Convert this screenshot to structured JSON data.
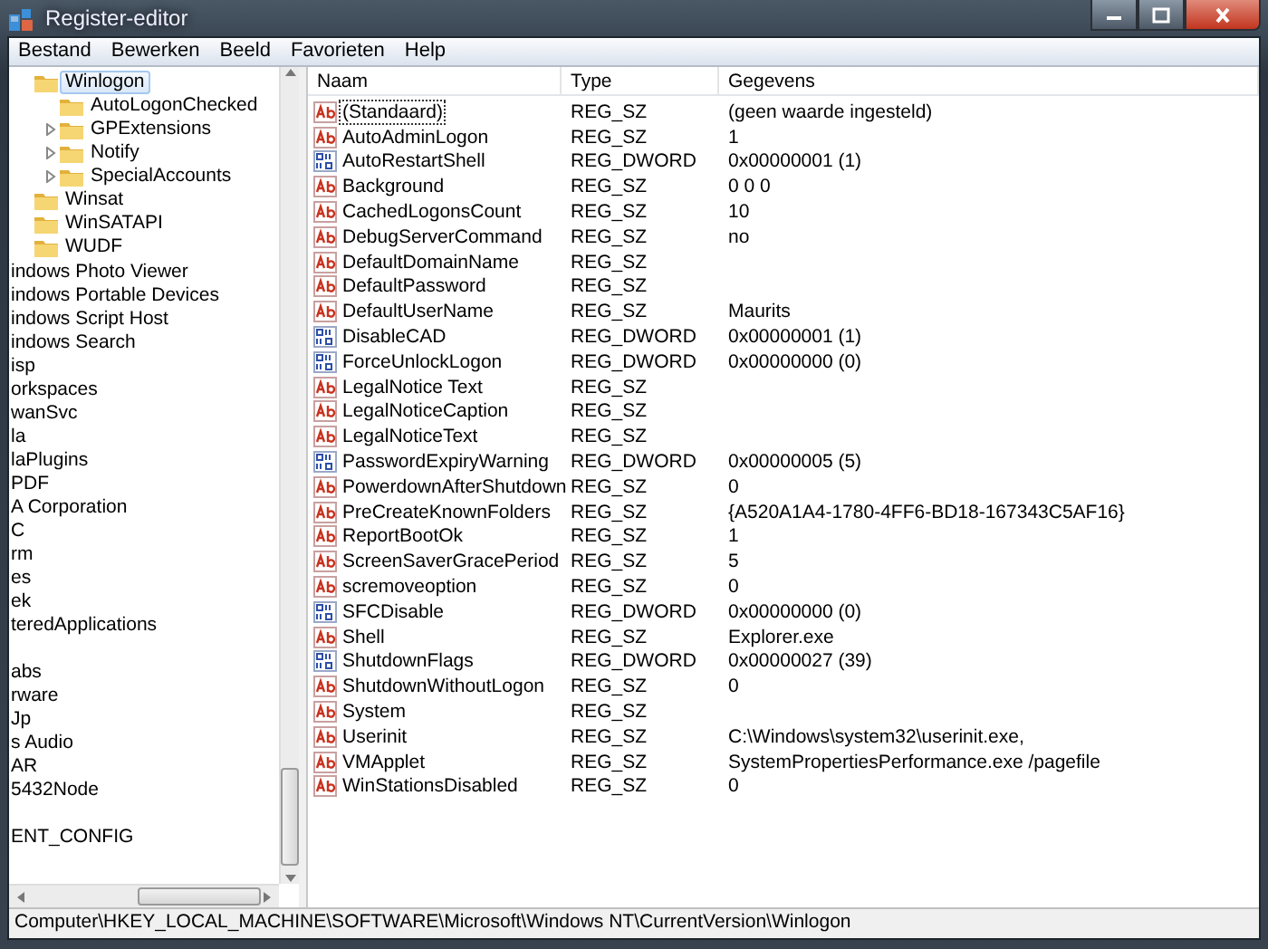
{
  "window": {
    "title": "Register-editor"
  },
  "menu": [
    "Bestand",
    "Bewerken",
    "Beeld",
    "Favorieten",
    "Help"
  ],
  "tree": {
    "nested_items": [
      {
        "label": "Winlogon",
        "selected": true,
        "expandable": false,
        "children": [
          {
            "label": "AutoLogonChecked",
            "selected": false,
            "expandable": false
          },
          {
            "label": "GPExtensions",
            "selected": false,
            "expandable": true
          },
          {
            "label": "Notify",
            "selected": false,
            "expandable": true
          },
          {
            "label": "SpecialAccounts",
            "selected": false,
            "expandable": true
          }
        ]
      },
      {
        "label": "Winsat",
        "selected": false,
        "expandable": false
      },
      {
        "label": "WinSATAPI",
        "selected": false,
        "expandable": false
      },
      {
        "label": "WUDF",
        "selected": false,
        "expandable": false
      }
    ],
    "items": [
      {
        "label": "indows Photo Viewer",
        "gap_before": false
      },
      {
        "label": "indows Portable Devices",
        "gap_before": false
      },
      {
        "label": "indows Script Host",
        "gap_before": false
      },
      {
        "label": "indows Search",
        "gap_before": false
      },
      {
        "label": "isp",
        "gap_before": false
      },
      {
        "label": "orkspaces",
        "gap_before": false
      },
      {
        "label": "wanSvc",
        "gap_before": false
      },
      {
        "label": "la",
        "gap_before": false
      },
      {
        "label": "laPlugins",
        "gap_before": false
      },
      {
        "label": "PDF",
        "gap_before": false
      },
      {
        "label": "A Corporation",
        "gap_before": false
      },
      {
        "label": "C",
        "gap_before": false
      },
      {
        "label": "rm",
        "gap_before": false
      },
      {
        "label": "es",
        "gap_before": false
      },
      {
        "label": "ek",
        "gap_before": false
      },
      {
        "label": "teredApplications",
        "gap_before": false
      },
      {
        "label": "abs",
        "gap_before": true
      },
      {
        "label": "rware",
        "gap_before": false
      },
      {
        "label": "Jp",
        "gap_before": false
      },
      {
        "label": "s Audio",
        "gap_before": false
      },
      {
        "label": "AR",
        "gap_before": false
      },
      {
        "label": "5432Node",
        "gap_before": false
      },
      {
        "label": "ENT_CONFIG",
        "gap_before": true
      }
    ]
  },
  "table": {
    "columns": [
      "Naam",
      "Type",
      "Gegevens"
    ],
    "rows": [
      {
        "kind": "string",
        "focused": true,
        "name": "(Standaard)",
        "type": "REG_SZ",
        "data": "(geen waarde ingesteld)"
      },
      {
        "kind": "string",
        "focused": false,
        "name": "AutoAdminLogon",
        "type": "REG_SZ",
        "data": "1"
      },
      {
        "kind": "dword",
        "focused": false,
        "name": "AutoRestartShell",
        "type": "REG_DWORD",
        "data": "0x00000001 (1)"
      },
      {
        "kind": "string",
        "focused": false,
        "name": "Background",
        "type": "REG_SZ",
        "data": "0 0 0"
      },
      {
        "kind": "string",
        "focused": false,
        "name": "CachedLogonsCount",
        "type": "REG_SZ",
        "data": "10"
      },
      {
        "kind": "string",
        "focused": false,
        "name": "DebugServerCommand",
        "type": "REG_SZ",
        "data": "no"
      },
      {
        "kind": "string",
        "focused": false,
        "name": "DefaultDomainName",
        "type": "REG_SZ"
      },
      {
        "kind": "string",
        "focused": false,
        "name": "DefaultPassword",
        "type": "REG_SZ"
      },
      {
        "kind": "string",
        "focused": false,
        "name": "DefaultUserName",
        "type": "REG_SZ",
        "data": "Maurits"
      },
      {
        "kind": "dword",
        "focused": false,
        "name": "DisableCAD",
        "type": "REG_DWORD",
        "data": "0x00000001 (1)"
      },
      {
        "kind": "dword",
        "focused": false,
        "name": "ForceUnlockLogon",
        "type": "REG_DWORD",
        "data": "0x00000000 (0)"
      },
      {
        "kind": "string",
        "focused": false,
        "name": "LegalNotice Text",
        "type": "REG_SZ"
      },
      {
        "kind": "string",
        "focused": false,
        "name": "LegalNoticeCaption",
        "type": "REG_SZ"
      },
      {
        "kind": "string",
        "focused": false,
        "name": "LegalNoticeText",
        "type": "REG_SZ"
      },
      {
        "kind": "dword",
        "focused": false,
        "name": "PasswordExpiryWarning",
        "type": "REG_DWORD",
        "data": "0x00000005 (5)"
      },
      {
        "kind": "string",
        "focused": false,
        "name": "PowerdownAfterShutdown",
        "type": "REG_SZ",
        "data": "0"
      },
      {
        "kind": "string",
        "focused": false,
        "name": "PreCreateKnownFolders",
        "type": "REG_SZ",
        "data": "{A520A1A4-1780-4FF6-BD18-167343C5AF16}"
      },
      {
        "kind": "string",
        "focused": false,
        "name": "ReportBootOk",
        "type": "REG_SZ",
        "data": "1"
      },
      {
        "kind": "string",
        "focused": false,
        "name": "ScreenSaverGracePeriod",
        "type": "REG_SZ",
        "data": "5"
      },
      {
        "kind": "string",
        "focused": false,
        "name": "scremoveoption",
        "type": "REG_SZ",
        "data": "0"
      },
      {
        "kind": "dword",
        "focused": false,
        "name": "SFCDisable",
        "type": "REG_DWORD",
        "data": "0x00000000 (0)"
      },
      {
        "kind": "string",
        "focused": false,
        "name": "Shell",
        "type": "REG_SZ",
        "data": "Explorer.exe"
      },
      {
        "kind": "dword",
        "focused": false,
        "name": "ShutdownFlags",
        "type": "REG_DWORD",
        "data": "0x00000027 (39)"
      },
      {
        "kind": "string",
        "focused": false,
        "name": "ShutdownWithoutLogon",
        "type": "REG_SZ",
        "data": "0"
      },
      {
        "kind": "string",
        "focused": false,
        "name": "System",
        "type": "REG_SZ"
      },
      {
        "kind": "string",
        "focused": false,
        "name": "Userinit",
        "type": "REG_SZ",
        "data": "C:\\Windows\\system32\\userinit.exe,"
      },
      {
        "kind": "string",
        "focused": false,
        "name": "VMApplet",
        "type": "REG_SZ",
        "data": "SystemPropertiesPerformance.exe /pagefile"
      },
      {
        "kind": "string",
        "focused": false,
        "name": "WinStationsDisabled",
        "type": "REG_SZ",
        "data": "0"
      }
    ]
  },
  "status_bar": "Computer\\HKEY_LOCAL_MACHINE\\SOFTWARE\\Microsoft\\Windows NT\\CurrentVersion\\Winlogon"
}
